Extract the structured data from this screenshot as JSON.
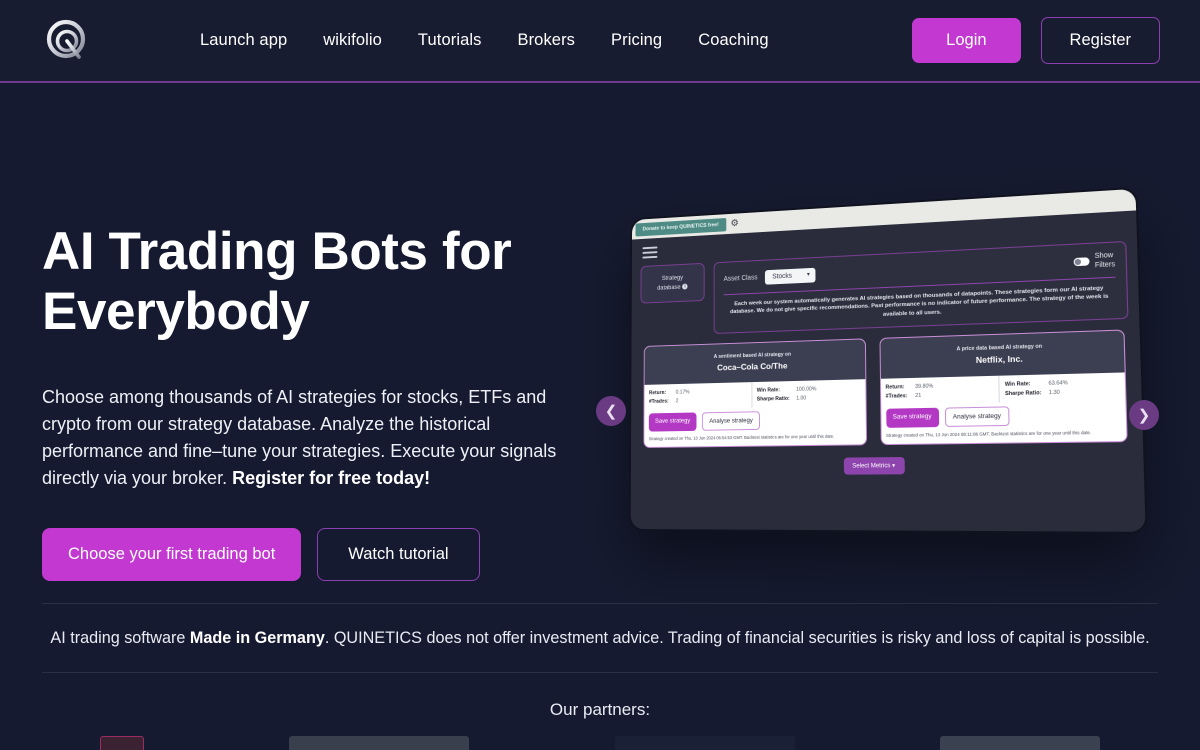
{
  "brand": {
    "logo_icon": "quinetics-q-logo",
    "name": "QUINETICS"
  },
  "colors": {
    "accent": "#c238d1",
    "accent_border": "#8b3fb0",
    "page_bg": "#151a30",
    "header_bg": "#181c30",
    "header_rule": "#6d3a8f"
  },
  "header": {
    "nav": [
      {
        "label": "Launch app"
      },
      {
        "label": "wikifolio"
      },
      {
        "label": "Tutorials"
      },
      {
        "label": "Brokers"
      },
      {
        "label": "Pricing"
      },
      {
        "label": "Coaching"
      }
    ],
    "login_label": "Login",
    "register_label": "Register"
  },
  "hero": {
    "title": "AI Trading Bots for Everybody",
    "subtitle_part1": "Choose among thousands of AI strategies for stocks, ETFs and crypto from our strategy database. Analyze the historical performance and fine–tune your strategies. Execute your signals directly via your broker. ",
    "subtitle_bold": "Register for free today!",
    "primary_cta": "Choose your first trading bot",
    "secondary_cta": "Watch tutorial"
  },
  "mockup": {
    "banner": "Donate to keep QUINETICS free!",
    "gear_icon": "gear-icon",
    "menu_icon": "hamburger-icon",
    "strategy_box_line1": "Strategy",
    "strategy_box_line2": "database",
    "info_icon": "i",
    "asset_class_label": "Asset Class",
    "asset_class_value": "Stocks",
    "show_filters_line1": "Show",
    "show_filters_line2": "Filters",
    "notice": "Each week our system automatically generates AI strategies based on thousands of datapoints. These strategies form our AI strategy database. We do not give specific recommendations. Past performance is no indicator of future performance. The strategy of the week is available to all users.",
    "select_metrics": "Select Metrics",
    "prev_icon": "chevron-left-icon",
    "next_icon": "chevron-right-icon",
    "cards": [
      {
        "kicker": "A sentiment based AI strategy on",
        "title": "Coca–Cola Co/The",
        "stats": [
          {
            "k": "Return:",
            "v": "0.17%"
          },
          {
            "k": "#Trades:",
            "v": "2"
          },
          {
            "k": "Win Rate:",
            "v": "100.00%"
          },
          {
            "k": "Sharpe Ratio:",
            "v": "1.00"
          }
        ],
        "save_label": "Save strategy",
        "analyse_label": "Analyse strategy",
        "footnote": "Strategy created on Thu, 13 Jun 2024 06:54:53 GMT. Backtest statistics are for one year until this date."
      },
      {
        "kicker": "A price data based AI strategy on",
        "title": "Netflix, Inc.",
        "stats": [
          {
            "k": "Return:",
            "v": "39.80%"
          },
          {
            "k": "#Trades:",
            "v": "21"
          },
          {
            "k": "Win Rate:",
            "v": "63.64%"
          },
          {
            "k": "Sharpe Ratio:",
            "v": "1.30"
          }
        ],
        "save_label": "Save strategy",
        "analyse_label": "Analyse strategy",
        "footnote": "Strategy created on Thu, 13 Jun 2024 08:11:08 GMT. Backtest statistics are for one year until this date."
      }
    ]
  },
  "disclaimer": {
    "part1": "AI trading software ",
    "bold": "Made in Germany",
    "part2": ". QUINETICS does not offer investment advice. Trading of financial securities is risky and loss of capital is possible."
  },
  "partners": {
    "title": "Our partners:"
  }
}
